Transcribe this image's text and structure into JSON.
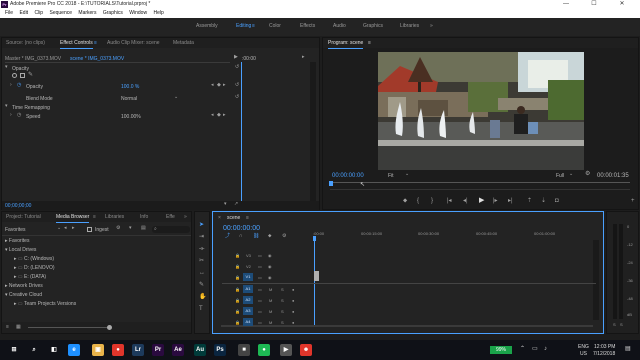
{
  "window": {
    "title": "Adobe Premiere Pro CC 2018 - E:\\TUTORIALS\\Tutorial.prproj *",
    "minimize": "—",
    "maximize": "☐",
    "close": "✕"
  },
  "menu": [
    "File",
    "Edit",
    "Clip",
    "Sequence",
    "Markers",
    "Graphics",
    "Window",
    "Help"
  ],
  "workspaces": {
    "items": [
      "Assembly",
      "Editing",
      "Color",
      "Effects",
      "Audio",
      "Graphics",
      "Libraries"
    ],
    "active": "Editing",
    "menu_glyph": "≡",
    "more": "»"
  },
  "source_panel": {
    "tabs": [
      "Source: (no clips)",
      "Effect Controls",
      "Audio Clip Mixer: scene",
      "Metadata"
    ],
    "active_tab": "Effect Controls",
    "menu_glyph": "≡",
    "master_label": "Master * IMG_0373.MOV",
    "clip_label": "scene * IMG_0373.MOV",
    "time_label": ":00:00",
    "opacity_section": "Opacity",
    "opacity_label": "Opacity",
    "opacity_value": "100.0 %",
    "blend_label": "Blend Mode",
    "blend_value": "Normal",
    "time_remap_label": "Time Remapping",
    "speed_label": "Speed",
    "speed_value": "100.00%",
    "timecode": "00;00;00;00"
  },
  "program_panel": {
    "title": "Program: scene",
    "menu_glyph": "≡",
    "timecode": "00:00:00:00",
    "fit": "Fit",
    "quality": "Full",
    "duration": "00:00:01:35",
    "controls": {
      "marker": "⬥",
      "in": "{",
      "out": "}",
      "go_in": "|◂",
      "step_back": "◂|",
      "play": "▶",
      "step_fwd": "|▸",
      "go_out": "▸|",
      "lift": "⇡",
      "extract": "⇣",
      "export_frame": "◘",
      "add": "+"
    }
  },
  "project_panel": {
    "tabs": [
      "Project: Tutorial",
      "Media Browser",
      "Libraries",
      "Info",
      "Effe"
    ],
    "active_tab": "Media Browser",
    "more": "»",
    "menu_glyph": "≡",
    "location": "Favorites",
    "ingest": "Ingest",
    "tree": [
      {
        "label": "Favorites",
        "indent": 0,
        "bullet": "▸"
      },
      {
        "label": "Local Drives",
        "indent": 0,
        "bullet": "▾"
      },
      {
        "label": "C: (Windows)",
        "indent": 2,
        "bullet": "▸"
      },
      {
        "label": "D: (LENOVO)",
        "indent": 2,
        "bullet": "▸"
      },
      {
        "label": "E: (DATA)",
        "indent": 2,
        "bullet": "▸"
      },
      {
        "label": "Network Drives",
        "indent": 0,
        "bullet": "▸"
      },
      {
        "label": "Creative Cloud",
        "indent": 0,
        "bullet": "▾"
      },
      {
        "label": "Team Projects Versions",
        "indent": 2,
        "bullet": "▸"
      }
    ]
  },
  "timeline": {
    "title": "scene",
    "close": "×",
    "menu_glyph": "≡",
    "timecode": "00:00:00:00",
    "ruler": [
      ":00:00",
      "00:00:15:00",
      "00:00:30:00",
      "00:00:45:00",
      "00:01:00:00"
    ],
    "tracks": [
      {
        "name": "V3",
        "kind": "video"
      },
      {
        "name": "V2",
        "kind": "video"
      },
      {
        "name": "V1",
        "kind": "video"
      },
      {
        "name": "A1",
        "kind": "audio"
      },
      {
        "name": "A2",
        "kind": "audio"
      },
      {
        "name": "A3",
        "kind": "audio"
      },
      {
        "name": "A4",
        "kind": "audio"
      }
    ],
    "mute": "M",
    "solo": "S",
    "db_labels": [
      "0",
      "-12",
      "-24",
      "-36",
      "-48",
      "dB"
    ],
    "solo_buttons": [
      "S",
      "S"
    ]
  },
  "taskbar": {
    "apps": [
      "⊞",
      "⌕",
      "◧",
      "e",
      "▣",
      "●",
      "Lr",
      "Pr",
      "Ae",
      "Au",
      "Ps",
      "■",
      "●",
      "▶",
      "☻"
    ],
    "app_colors": [
      "#ffffff",
      "#ffffff",
      "#ffffff",
      "#1e90ff",
      "#e8b34a",
      "#e0352b",
      "#1d3a5c",
      "#2a0a3f",
      "#2a0a3f",
      "#003b3a",
      "#0a2540",
      "#444444",
      "#1db954",
      "#555555",
      "#e0352b"
    ],
    "battery": "99%",
    "tray_icons": [
      "⌃",
      "▭",
      "♪"
    ],
    "lang": "ENG",
    "region": "US",
    "time": "12:03 PM",
    "date": "7/12/2018",
    "notify": "▤"
  }
}
